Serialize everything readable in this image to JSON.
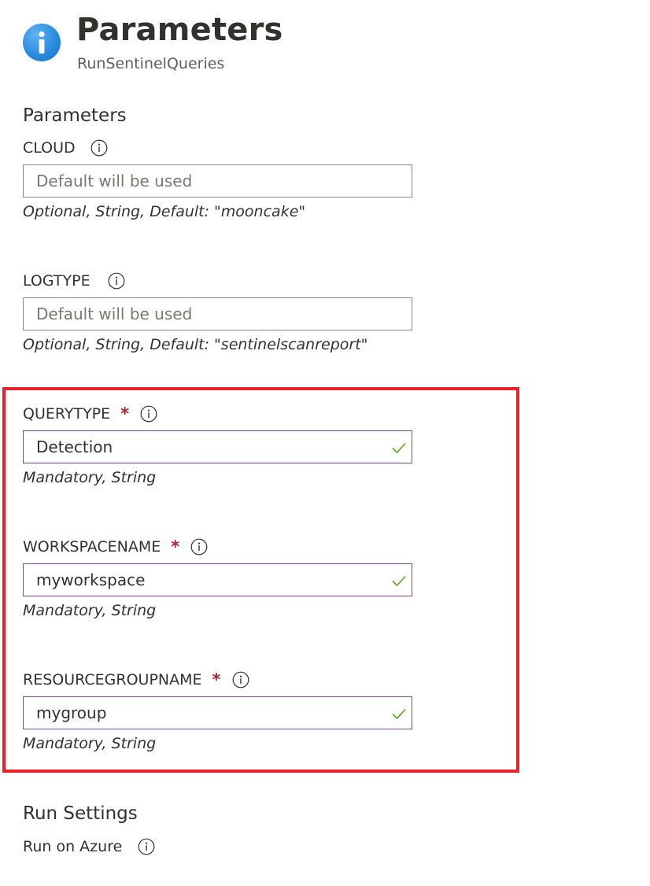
{
  "header": {
    "icon": "info-icon",
    "title": "Parameters",
    "subtitle": "RunSentinelQueries"
  },
  "parameters_section": {
    "heading": "Parameters",
    "fields": [
      {
        "label": "CLOUD",
        "required": false,
        "value": "",
        "placeholder": "Default will be used",
        "hint": "Optional, String, Default: \"mooncake\""
      },
      {
        "label": "LOGTYPE",
        "required": false,
        "value": "",
        "placeholder": "Default will be used",
        "hint": "Optional, String, Default: \"sentinelscanreport\""
      },
      {
        "label": "QUERYTYPE",
        "required": true,
        "required_mark": "*",
        "value": "Detection",
        "hint": "Mandatory, String",
        "valid": true
      },
      {
        "label": "WORKSPACENAME",
        "required": true,
        "required_mark": "*",
        "value": "myworkspace",
        "hint": "Mandatory, String",
        "valid": true
      },
      {
        "label": "RESOURCEGROUPNAME",
        "required": true,
        "required_mark": "*",
        "value": "mygroup",
        "hint": "Mandatory, String",
        "valid": true
      }
    ]
  },
  "run_settings": {
    "heading": "Run Settings",
    "run_on_label": "Run on Azure"
  },
  "colors": {
    "highlight_border": "#e8212a",
    "required_star": "#a4262c",
    "valid_check": "#5ba71b",
    "valid_input_border": "#7a4a8c",
    "info_badge": "#2b8be0"
  }
}
